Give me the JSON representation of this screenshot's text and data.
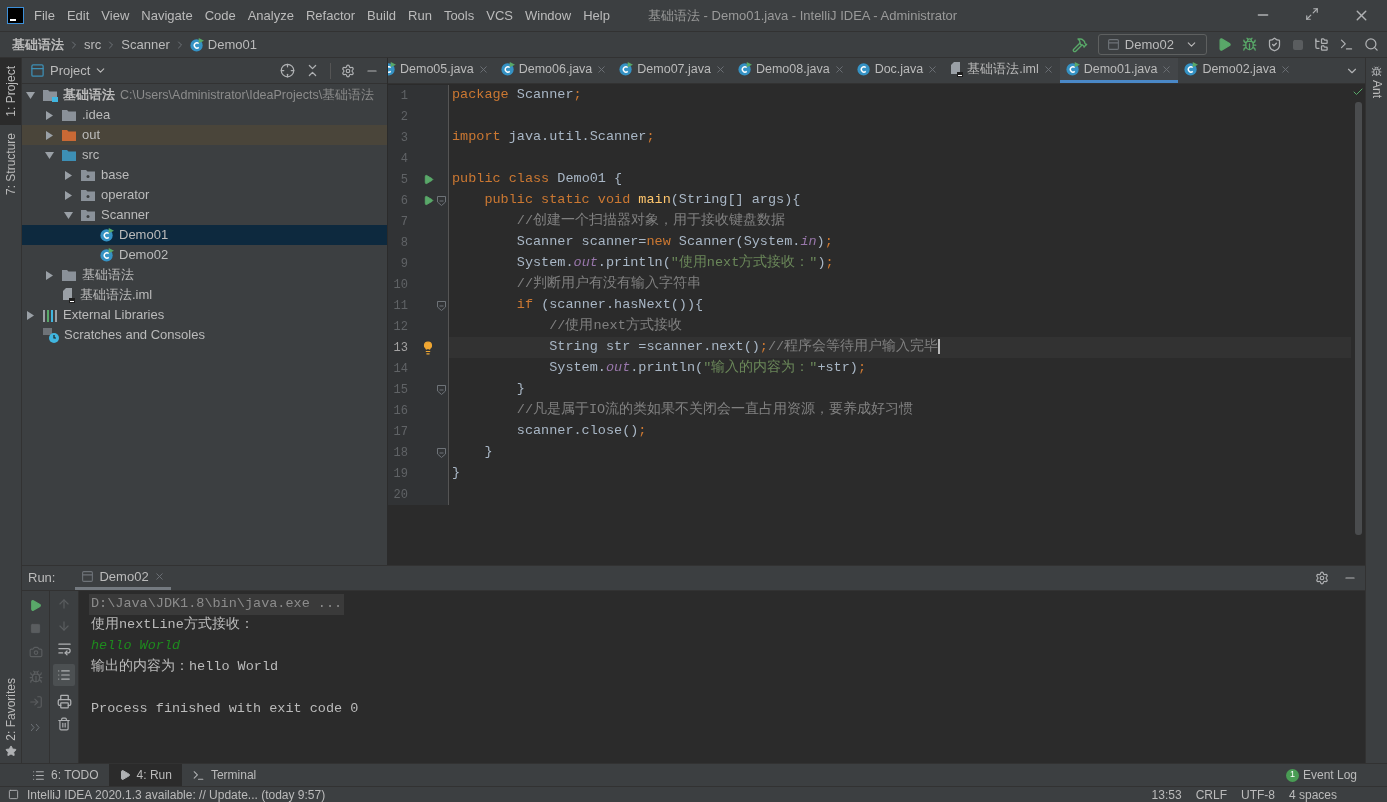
{
  "window": {
    "title": "基础语法 - Demo01.java - IntelliJ IDEA - Administrator"
  },
  "menu": [
    "File",
    "Edit",
    "View",
    "Navigate",
    "Code",
    "Analyze",
    "Refactor",
    "Build",
    "Run",
    "Tools",
    "VCS",
    "Window",
    "Help"
  ],
  "breadcrumbs": [
    {
      "label": "基础语法",
      "kind": "module"
    },
    {
      "label": "src",
      "kind": "folder"
    },
    {
      "label": "Scanner",
      "kind": "folder"
    },
    {
      "label": "Demo01",
      "kind": "class"
    }
  ],
  "run_config": "Demo02",
  "left_strip": [
    {
      "label": "1: Project",
      "selected": true
    },
    {
      "label": "7: Structure",
      "selected": false
    }
  ],
  "favorites_tab": "2: Favorites",
  "right_strip": "Ant",
  "project_panel": {
    "title": "Project",
    "tree": [
      {
        "label": "基础语法",
        "hint": "C:\\Users\\Administrator\\IdeaProjects\\基础语法",
        "kind": "module",
        "expanded": true,
        "selected": false,
        "children": [
          {
            "label": ".idea",
            "kind": "folder",
            "expanded": false,
            "selected": false
          },
          {
            "label": "out",
            "kind": "excluded",
            "expanded": false,
            "selected": false
          },
          {
            "label": "src",
            "kind": "source",
            "expanded": true,
            "selected": false,
            "children": [
              {
                "label": "base",
                "kind": "package",
                "expanded": false,
                "selected": false
              },
              {
                "label": "operator",
                "kind": "package",
                "expanded": false,
                "selected": false
              },
              {
                "label": "Scanner",
                "kind": "package",
                "expanded": true,
                "selected": false,
                "children": [
                  {
                    "label": "Demo01",
                    "kind": "class",
                    "selected": true
                  },
                  {
                    "label": "Demo02",
                    "kind": "class",
                    "selected": false
                  }
                ]
              }
            ]
          },
          {
            "label": "基础语法",
            "kind": "folder",
            "expanded": false,
            "selected": false
          },
          {
            "label": "基础语法.iml",
            "kind": "file",
            "selected": false
          }
        ]
      },
      {
        "label": "External Libraries",
        "kind": "libraries",
        "expanded": false,
        "selected": false
      },
      {
        "label": "Scratches and Consoles",
        "kind": "scratches",
        "selected": false
      }
    ]
  },
  "editor_tabs": [
    {
      "label": "Demo05.java",
      "kind": "class",
      "selected": false
    },
    {
      "label": "Demo06.java",
      "kind": "class",
      "selected": false
    },
    {
      "label": "Demo07.java",
      "kind": "class",
      "selected": false
    },
    {
      "label": "Demo08.java",
      "kind": "class",
      "selected": false
    },
    {
      "label": "Doc.java",
      "kind": "plain",
      "selected": false
    },
    {
      "label": "基础语法.iml",
      "kind": "file",
      "selected": false
    },
    {
      "label": "Demo01.java",
      "kind": "class",
      "selected": true
    },
    {
      "label": "Demo02.java",
      "kind": "class",
      "selected": false
    }
  ],
  "code": [
    {
      "number": "1",
      "tokens": [
        {
          "kind": "keyword",
          "text": "package"
        },
        {
          "kind": "plain",
          "text": " Scanner"
        },
        {
          "kind": "keyword",
          "text": ";"
        }
      ]
    },
    {
      "number": "2"
    },
    {
      "number": "3",
      "tokens": [
        {
          "kind": "keyword",
          "text": "import"
        },
        {
          "kind": "plain",
          "text": " java.util.Scanner"
        },
        {
          "kind": "keyword",
          "text": ";"
        }
      ]
    },
    {
      "number": "4"
    },
    {
      "number": "5",
      "run": true,
      "tokens": [
        {
          "kind": "keyword",
          "text": "public class "
        },
        {
          "kind": "plain",
          "text": "Demo01 {"
        }
      ]
    },
    {
      "number": "6",
      "run": true,
      "fold": true,
      "tokens": [
        {
          "kind": "keyword",
          "text": "    public static void "
        },
        {
          "kind": "method",
          "text": "main"
        },
        {
          "kind": "plain",
          "text": "(String[] args){"
        }
      ]
    },
    {
      "number": "7",
      "tokens": [
        {
          "kind": "comment",
          "text": "        //创建一个扫描器对象，用于接收键盘数据"
        }
      ]
    },
    {
      "number": "8",
      "tokens": [
        {
          "kind": "plain",
          "text": "        Scanner scanner="
        },
        {
          "kind": "keyword",
          "text": "new "
        },
        {
          "kind": "plain",
          "text": "Scanner(System."
        },
        {
          "kind": "field",
          "text": "in"
        },
        {
          "kind": "plain",
          "text": ")"
        },
        {
          "kind": "keyword",
          "text": ";"
        }
      ]
    },
    {
      "number": "9",
      "tokens": [
        {
          "kind": "plain",
          "text": "        System."
        },
        {
          "kind": "field",
          "text": "out"
        },
        {
          "kind": "plain",
          "text": ".println("
        },
        {
          "kind": "string",
          "text": "\"使用next方式接收：\""
        },
        {
          "kind": "plain",
          "text": ")"
        },
        {
          "kind": "keyword",
          "text": ";"
        }
      ]
    },
    {
      "number": "10",
      "tokens": [
        {
          "kind": "comment",
          "text": "        //判断用户有没有输入字符串"
        }
      ]
    },
    {
      "number": "11",
      "fold": true,
      "tokens": [
        {
          "kind": "keyword",
          "text": "        if "
        },
        {
          "kind": "plain",
          "text": "(scanner.hasNext()){"
        }
      ]
    },
    {
      "number": "12",
      "tokens": [
        {
          "kind": "comment",
          "text": "            //使用next方式接收"
        }
      ]
    },
    {
      "number": "13",
      "current": true,
      "bulb": true,
      "tokens": [
        {
          "kind": "plain",
          "text": "            String str =scanner.next()"
        },
        {
          "kind": "keyword",
          "text": ";"
        },
        {
          "kind": "comment",
          "text": "//程序会等待用户输入完毕"
        }
      ]
    },
    {
      "number": "14",
      "tokens": [
        {
          "kind": "plain",
          "text": "            System."
        },
        {
          "kind": "field",
          "text": "out"
        },
        {
          "kind": "plain",
          "text": ".println("
        },
        {
          "kind": "string",
          "text": "\"输入的内容为：\""
        },
        {
          "kind": "plain",
          "text": "+str)"
        },
        {
          "kind": "keyword",
          "text": ";"
        }
      ]
    },
    {
      "number": "15",
      "fold": true,
      "tokens": [
        {
          "kind": "plain",
          "text": "        }"
        }
      ]
    },
    {
      "number": "16",
      "tokens": [
        {
          "kind": "comment",
          "text": "        //凡是属于IO流的类如果不关闭会一直占用资源，要养成好习惯"
        }
      ]
    },
    {
      "number": "17",
      "tokens": [
        {
          "kind": "plain",
          "text": "        scanner.close()"
        },
        {
          "kind": "keyword",
          "text": ";"
        }
      ]
    },
    {
      "number": "18",
      "fold": true,
      "tokens": [
        {
          "kind": "plain",
          "text": "    }"
        }
      ]
    },
    {
      "number": "19",
      "tokens": [
        {
          "kind": "plain",
          "text": "}"
        }
      ]
    },
    {
      "number": "20"
    }
  ],
  "run_panel": {
    "label": "Run:",
    "tab": "Demo02",
    "console": [
      {
        "kind": "command",
        "text": "D:\\Java\\JDK1.8\\bin\\java.exe ..."
      },
      {
        "kind": "output",
        "text": "使用nextLine方式接收："
      },
      {
        "kind": "input",
        "text": "hello World"
      },
      {
        "kind": "output",
        "text": "输出的内容为：hello World"
      },
      {
        "kind": "blank"
      },
      {
        "kind": "output",
        "text": "Process finished with exit code 0"
      }
    ]
  },
  "tool_tabs": [
    {
      "label": "6: TODO",
      "kind": "todo",
      "selected": false
    },
    {
      "label": "4: Run",
      "kind": "run",
      "selected": true
    },
    {
      "label": "Terminal",
      "kind": "terminal",
      "selected": false
    }
  ],
  "event_log": {
    "label": "Event Log",
    "count": "1"
  },
  "status_bar": {
    "message": "IntelliJ IDEA 2020.1.3 available: // Update... (today 9:57)",
    "items": [
      "13:53",
      "CRLF",
      "UTF-8",
      "4 spaces"
    ]
  }
}
